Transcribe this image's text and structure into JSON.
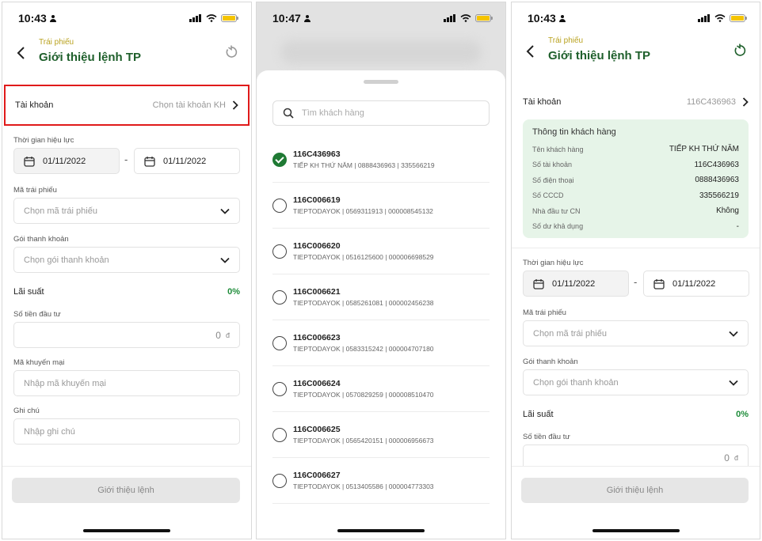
{
  "status": {
    "p1_time": "10:43",
    "p2_time": "10:47",
    "p3_time": "10:43"
  },
  "header": {
    "subtitle": "Trái phiếu",
    "title": "Giới thiệu lệnh TP"
  },
  "form": {
    "account_label": "Tài khoản",
    "account_placeholder": "Chọn tài khoản KH",
    "validity_label": "Thời gian hiệu lực",
    "date_from": "01/11/2022",
    "date_to": "01/11/2022",
    "date_sep": "-",
    "bond_code_label": "Mã trái phiếu",
    "bond_code_placeholder": "Chọn mã trái phiếu",
    "package_label": "Gói thanh khoản",
    "package_placeholder": "Chọn gói thanh khoản",
    "interest_label": "Lãi suất",
    "interest_value": "0%",
    "amount_label": "Số tiền đầu tư",
    "amount_value": "0",
    "amount_unit": "đ",
    "promo_label": "Mã khuyến mại",
    "promo_placeholder": "Nhập mã khuyến mại",
    "note_label": "Ghi chú",
    "note_placeholder": "Nhập ghi chú",
    "submit_label": "Giới thiệu lệnh"
  },
  "picker": {
    "search_placeholder": "Tìm khách hàng",
    "items": [
      {
        "code": "116C436963",
        "desc": "TIẾP KH THỨ NĂM | 0888436963 | 335566219",
        "selected": true
      },
      {
        "code": "116C006619",
        "desc": "TIEPTODAYOK | 0569311913 | 000008545132",
        "selected": false
      },
      {
        "code": "116C006620",
        "desc": "TIEPTODAYOK | 0516125600 | 000006698529",
        "selected": false
      },
      {
        "code": "116C006621",
        "desc": "TIEPTODAYOK | 0585261081 | 000002456238",
        "selected": false
      },
      {
        "code": "116C006623",
        "desc": "TIEPTODAYOK | 0583315242 | 000004707180",
        "selected": false
      },
      {
        "code": "116C006624",
        "desc": "TIEPTODAYOK | 0570829259 | 000008510470",
        "selected": false
      },
      {
        "code": "116C006625",
        "desc": "TIEPTODAYOK | 0565420151 | 000006956673",
        "selected": false
      },
      {
        "code": "116C006627",
        "desc": "TIEPTODAYOK | 0513405586 | 000004773303",
        "selected": false
      }
    ]
  },
  "selected": {
    "account_value": "116C436963",
    "info_title": "Thông tin khách hàng",
    "info": {
      "name_label": "Tên khách hàng",
      "name": "TIẾP KH THỨ NĂM",
      "acc_label": "Số tài khoản",
      "acc": "116C436963",
      "phone_label": "Số điện thoại",
      "phone": "0888436963",
      "id_label": "Số CCCD",
      "id": "335566219",
      "pro_label": "Nhà đầu tư CN",
      "pro": "Không",
      "balance_label": "Số dư khả dụng",
      "balance": "-"
    }
  },
  "colors": {
    "accent_green": "#1e5f2b",
    "highlight_red": "#e01a1a",
    "subtitle_gold": "#b9a21f",
    "info_bg": "#e6f4e8"
  }
}
